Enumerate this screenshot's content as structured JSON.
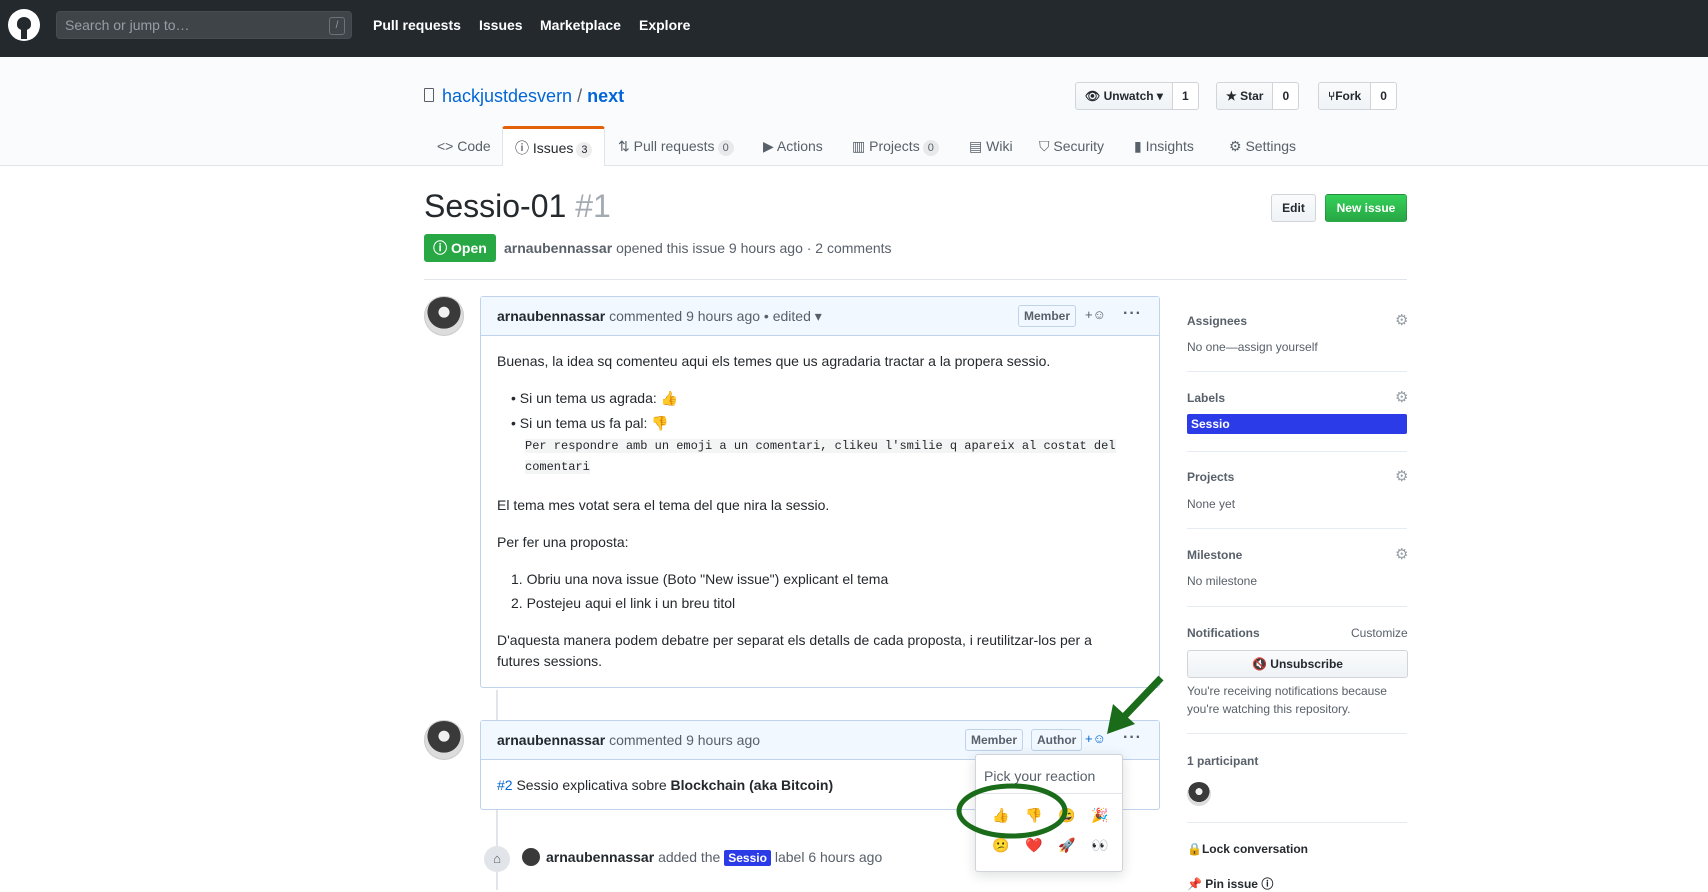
{
  "header": {
    "search_placeholder": "Search or jump to…",
    "slash": "/",
    "nav": [
      "Pull requests",
      "Issues",
      "Marketplace",
      "Explore"
    ]
  },
  "repo": {
    "owner": "hackjustdesvern",
    "name": "next",
    "separator": "/",
    "watch_label": "Unwatch",
    "watch_count": "1",
    "star_label": "Star",
    "star_count": "0",
    "fork_label": "Fork",
    "fork_count": "0"
  },
  "tabs": [
    {
      "label": "Code"
    },
    {
      "label": "Issues",
      "count": "3"
    },
    {
      "label": "Pull requests",
      "count": "0"
    },
    {
      "label": "Actions"
    },
    {
      "label": "Projects",
      "count": "0"
    },
    {
      "label": "Wiki"
    },
    {
      "label": "Security"
    },
    {
      "label": "Insights"
    },
    {
      "label": "Settings"
    }
  ],
  "issue": {
    "title": "Sessio-01",
    "number": "#1",
    "edit_label": "Edit",
    "new_issue_label": "New issue",
    "state": "Open",
    "author": "arnaubennassar",
    "meta_text": "opened this issue 9 hours ago · 2 comments"
  },
  "comment1": {
    "author": "arnaubennassar",
    "meta": "commented 9 hours ago • edited",
    "badge": "Member",
    "intro": "Buenas, la idea sq comenteu aqui els temes que us agradaria tractar a la propera sessio.",
    "bullet1": "Si un tema us agrada: 👍",
    "bullet2": "Si un tema us fa pal: 👎",
    "code_line1": "Per respondre amb un emoji a un comentari, clikeu l'smilie q apareix al costat del",
    "code_line2": "comentari",
    "para2": "El tema mes votat sera el tema del que nira la sessio.",
    "para3": "Per fer una proposta:",
    "step1": "Obriu una nova issue (Boto \"New issue\") explicant el tema",
    "step2": "Postejeu aqui el link i un breu titol",
    "para4a": "D'aquesta manera podem debatre per separat els detalls de cada proposta, i reutilitzar-los per a",
    "para4b": "futures sessions."
  },
  "comment2": {
    "author": "arnaubennassar",
    "meta": "commented 9 hours ago",
    "badge_member": "Member",
    "badge_author": "Author",
    "link": "#2",
    "text": "Sessio explicativa sobre",
    "bold": "Blockchain (aka Bitcoin)"
  },
  "event": {
    "author": "arnaubennassar",
    "pre": "added the",
    "label": "Sessio",
    "post": "label 6 hours ago"
  },
  "reaction_popover": {
    "title": "Pick your reaction",
    "emojis": [
      "👍",
      "👎",
      "😄",
      "🎉",
      "😕",
      "❤️",
      "🚀",
      "👀"
    ]
  },
  "sidebar": {
    "assignees_title": "Assignees",
    "assignees_value": "No one—assign yourself",
    "labels_title": "Labels",
    "label_name": "Sessio",
    "label_color": "#2b3be8",
    "projects_title": "Projects",
    "projects_value": "None yet",
    "milestone_title": "Milestone",
    "milestone_value": "No milestone",
    "notifications_title": "Notifications",
    "customize": "Customize",
    "unsubscribe": "Unsubscribe",
    "notif_reason1": "You're receiving notifications because",
    "notif_reason2": "you're watching this repository.",
    "participants": "1 participant",
    "lock": "Lock conversation",
    "pin": "Pin issue"
  },
  "colors": {
    "header_bg": "#24292e",
    "link": "#0366d6",
    "open_green": "#28a745",
    "annotation_green": "#1a6b1a"
  }
}
